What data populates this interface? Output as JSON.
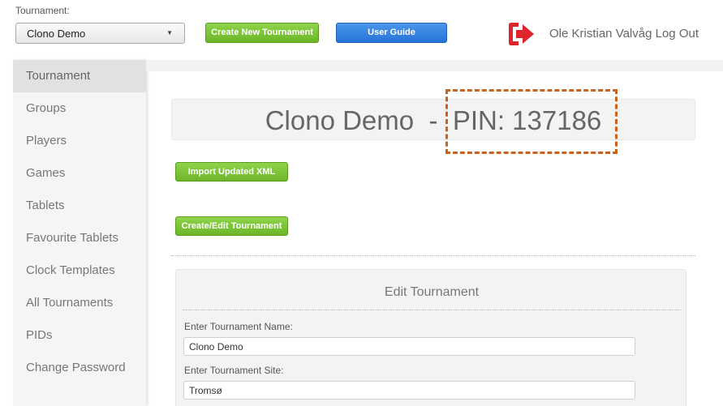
{
  "header": {
    "tournament_label": "Tournament:",
    "tournament_select": "Clono Demo",
    "create_new_label": "Create New Tournament",
    "user_guide_label": "User Guide",
    "user_name": "Ole Kristian Valvåg",
    "logout_label": "Log Out",
    "logout_icon": "sign-out-icon"
  },
  "sidebar": {
    "items": [
      {
        "label": "Tournament",
        "active": true
      },
      {
        "label": "Groups"
      },
      {
        "label": "Players"
      },
      {
        "label": "Games"
      },
      {
        "label": "Tablets"
      },
      {
        "label": "Favourite Tablets"
      },
      {
        "label": "Clock Templates"
      },
      {
        "label": "All Tournaments"
      },
      {
        "label": "PIDs"
      },
      {
        "label": "Change Password"
      }
    ]
  },
  "main": {
    "tournament_name": "Clono Demo",
    "separator": "-",
    "pin_text": "PIN: 137186",
    "import_label": "Import Updated XML",
    "create_edit_label": "Create/Edit Tournament"
  },
  "edit_form": {
    "title": "Edit Tournament",
    "name_label": "Enter Tournament Name:",
    "name_value": "Clono Demo",
    "site_label": "Enter Tournament Site:",
    "site_value": "Tromsø"
  },
  "colors": {
    "green_button": "#7cc437",
    "blue_button": "#3584e4",
    "logout_icon": "#e0242b",
    "highlight_dash": "#c9621e"
  }
}
